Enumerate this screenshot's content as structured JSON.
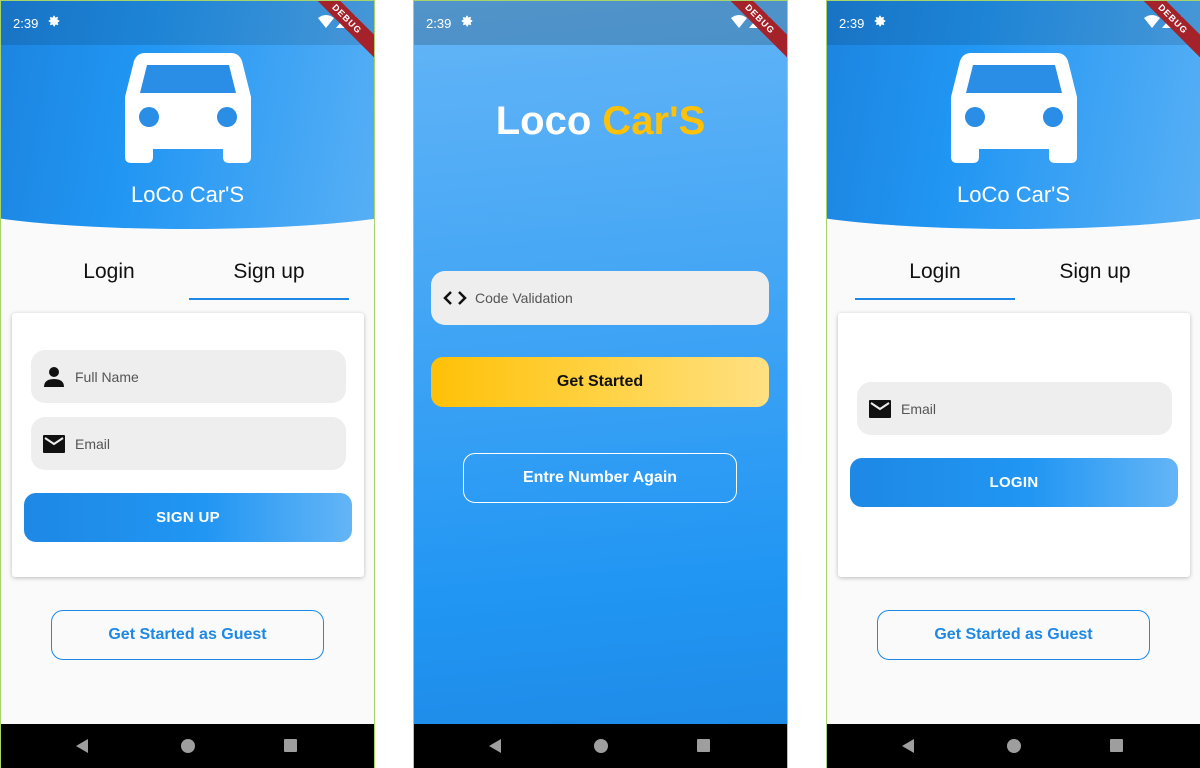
{
  "status_bar": {
    "time": "2:39",
    "debug_label": "DEBUG"
  },
  "brand": {
    "name": "LoCo Car'S"
  },
  "tabs": {
    "login": "Login",
    "signup": "Sign up"
  },
  "signup_screen": {
    "full_name_placeholder": "Full Name",
    "email_placeholder": "Email",
    "signup_button": "SIGN UP",
    "guest_button": "Get Started as Guest"
  },
  "validation_screen": {
    "title_part1": "Loco",
    "title_part2": "Car'S",
    "code_placeholder": "Code Validation",
    "get_started_button": "Get Started",
    "reenter_button": "Entre Number Again"
  },
  "login_screen": {
    "email_placeholder": "Email",
    "login_button": "LOGIN",
    "guest_button": "Get Started as Guest"
  },
  "colors": {
    "primary": "#1e88e5",
    "accent": "#ffc107",
    "field_bg": "#eeeeee"
  }
}
